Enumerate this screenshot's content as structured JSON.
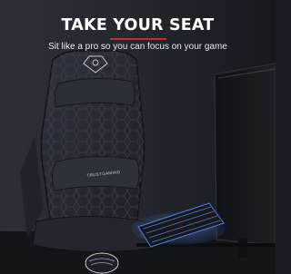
{
  "hero": {
    "title": "TAKE YOUR SEAT",
    "subtitle": "Sit like a pro so you can focus on your game",
    "accent_color": "#d4252e"
  },
  "chair": {
    "brand_text": "TRUSTGAMING",
    "logo_icon": "trust-gaming-emblem-icon"
  },
  "palette": {
    "background": "#1b1d22",
    "chair": "#262a31",
    "keyboard_glow": "#3a6fd8"
  }
}
